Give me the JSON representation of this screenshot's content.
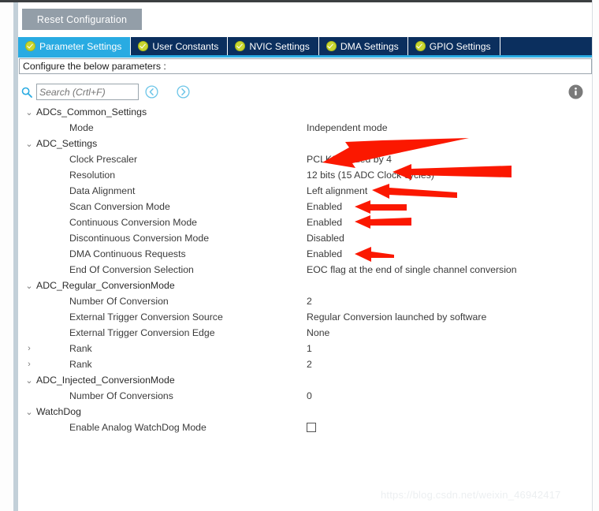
{
  "toolbar": {
    "reset_label": "Reset Configuration"
  },
  "tabs": [
    {
      "label": "Parameter Settings",
      "icon": "check-badge-icon",
      "active": true
    },
    {
      "label": "User Constants",
      "icon": "check-badge-icon",
      "active": false
    },
    {
      "label": "NVIC Settings",
      "icon": "check-badge-icon",
      "active": false
    },
    {
      "label": "DMA Settings",
      "icon": "check-badge-icon",
      "active": false
    },
    {
      "label": "GPIO Settings",
      "icon": "check-badge-icon",
      "active": false
    }
  ],
  "configbar": {
    "text": "Configure the below parameters :"
  },
  "search": {
    "placeholder": "Search (Crtl+F)",
    "value": "",
    "icon": "search-icon",
    "prev_icon": "chevron-left-circle-icon",
    "next_icon": "chevron-right-circle-icon",
    "info_icon": "info-circle-icon"
  },
  "tree": {
    "rows": [
      {
        "kind": "group",
        "expanded": true,
        "label": "ADCs_Common_Settings",
        "value": ""
      },
      {
        "kind": "leaf",
        "label": "Mode",
        "value": "Independent mode"
      },
      {
        "kind": "group",
        "expanded": true,
        "label": "ADC_Settings",
        "value": ""
      },
      {
        "kind": "leaf",
        "label": "Clock Prescaler",
        "value": "PCLK2 divided by 4"
      },
      {
        "kind": "leaf",
        "label": "Resolution",
        "value": "12 bits (15 ADC Clock cycles)"
      },
      {
        "kind": "leaf",
        "label": "Data Alignment",
        "value": "Left alignment"
      },
      {
        "kind": "leaf",
        "label": "Scan Conversion Mode",
        "value": "Enabled"
      },
      {
        "kind": "leaf",
        "label": "Continuous Conversion Mode",
        "value": "Enabled"
      },
      {
        "kind": "leaf",
        "label": "Discontinuous Conversion Mode",
        "value": "Disabled"
      },
      {
        "kind": "leaf",
        "label": "DMA Continuous Requests",
        "value": "Enabled"
      },
      {
        "kind": "leaf",
        "label": "End Of Conversion Selection",
        "value": "EOC flag at the end of single channel conversion"
      },
      {
        "kind": "group",
        "expanded": true,
        "label": "ADC_Regular_ConversionMode",
        "value": ""
      },
      {
        "kind": "leaf",
        "label": "Number Of Conversion",
        "value": "2"
      },
      {
        "kind": "leaf",
        "label": "External Trigger Conversion Source",
        "value": "Regular Conversion launched by software"
      },
      {
        "kind": "leaf",
        "label": "External Trigger Conversion Edge",
        "value": "None"
      },
      {
        "kind": "subgroup",
        "expanded": false,
        "label": "Rank",
        "value": "1"
      },
      {
        "kind": "subgroup",
        "expanded": false,
        "label": "Rank",
        "value": "2"
      },
      {
        "kind": "group",
        "expanded": true,
        "label": "ADC_Injected_ConversionMode",
        "value": ""
      },
      {
        "kind": "leaf",
        "label": "Number Of Conversions",
        "value": "0"
      },
      {
        "kind": "group",
        "expanded": true,
        "label": "WatchDog",
        "value": ""
      },
      {
        "kind": "leaf",
        "label": "Enable Analog WatchDog Mode",
        "value": "",
        "checkbox": false
      }
    ],
    "chevron_expanded": "⌄",
    "chevron_collapsed": "›"
  },
  "annotations": {
    "color": "#fb1800",
    "arrows": [
      {
        "name": "arrow-clock-prescaler"
      },
      {
        "name": "arrow-resolution"
      },
      {
        "name": "arrow-data-alignment"
      },
      {
        "name": "arrow-scan-conversion-mode"
      },
      {
        "name": "arrow-continuous-conversion-mode"
      },
      {
        "name": "arrow-dma-continuous-requests"
      }
    ]
  },
  "watermark": {
    "text": "https://blog.csdn.net/weixin_46942417"
  },
  "colors": {
    "tab_active": "#29abe2",
    "tab_bar": "#0b2f5e",
    "reset_button": "#939ea8",
    "arrow_red": "#fb1800"
  }
}
